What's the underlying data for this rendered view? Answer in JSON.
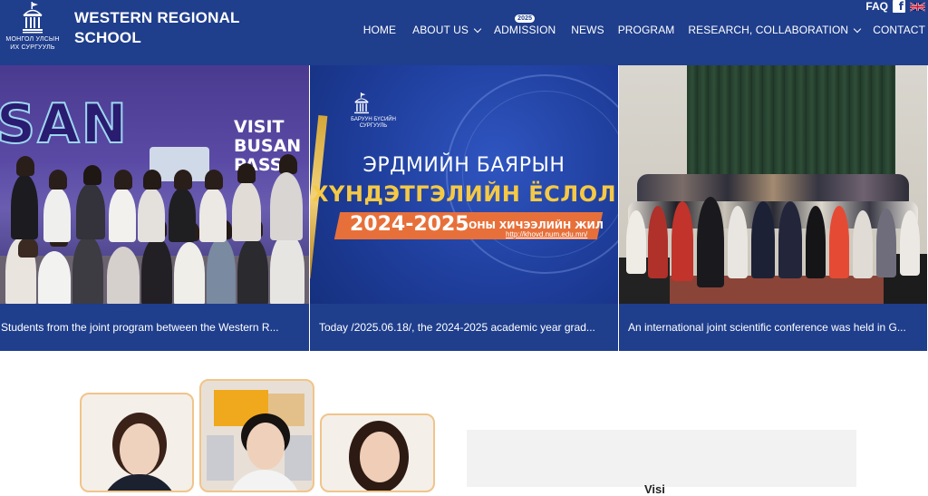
{
  "header": {
    "logo_text_line1": "МОНГОЛ УЛСЫН",
    "logo_text_line2": "ИХ СУРГУУЛЬ",
    "school_name_line1": "WESTERN REGIONAL",
    "school_name_line2": "SCHOOL",
    "faq_label": "FAQ",
    "facebook_glyph": "f",
    "nav": [
      {
        "label": "HOME"
      },
      {
        "label": "ABOUT US"
      },
      {
        "label": "ADMISSION",
        "badge": "2025"
      },
      {
        "label": "NEWS"
      },
      {
        "label": "PROGRAM"
      },
      {
        "label": "RESEARCH, COLLABORATION"
      },
      {
        "label": "CONTACT"
      }
    ]
  },
  "slider": {
    "slides": [
      {
        "caption": "Students from the joint program between the Western R...",
        "image_text": {
          "san": "SAN",
          "visit": "VISIT",
          "busan": "BUSAN",
          "pass": "PASS"
        }
      },
      {
        "caption": "Today /2025.06.18/, the 2024-2025 academic year grad...",
        "image_text": {
          "logo_line1": "БАРУУН БҮСИЙН",
          "logo_line2": "СУРГУУЛЬ",
          "title1": "ЭРДМИЙН БАЯРЫН",
          "title2": "ХҮНДЭТГЭЛИЙН ЁСЛОЛ",
          "years": "2024-2025",
          "subtitle": "ОНЫ ХИЧЭЭЛИЙН ЖИЛ",
          "url": "http://khovd.num.edu.mn/"
        }
      },
      {
        "caption": "An international joint scientific conference was held in G..."
      }
    ]
  },
  "vision": {
    "label": "Visi"
  },
  "colors": {
    "brand_blue": "#1f3e8c",
    "card_border": "#f0c48a",
    "panel_bg": "#f2f2f2"
  }
}
